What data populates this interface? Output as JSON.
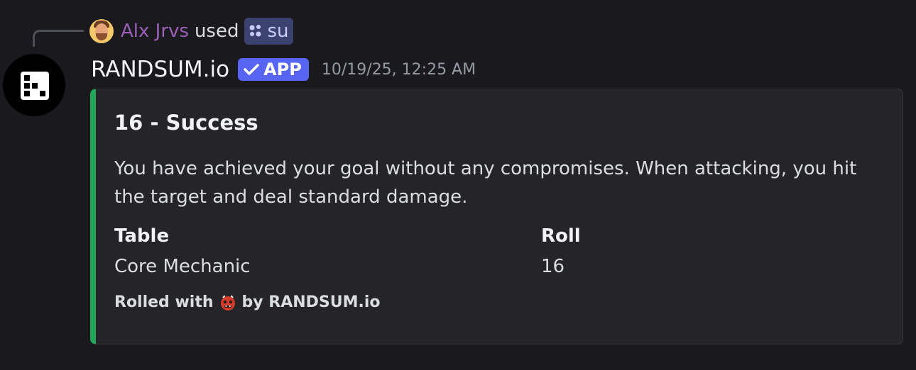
{
  "reply": {
    "user": "Alx Jrvs",
    "action": "used",
    "command": "su"
  },
  "message": {
    "author": "RANDSUM.io",
    "badge": "APP",
    "timestamp": "10/19/25, 12:25 AM"
  },
  "embed": {
    "accent_color": "#23a559",
    "title": "16 - Success",
    "description": "You have achieved your goal without any compromises. When attacking, you hit the target and deal standard damage.",
    "fields": [
      {
        "name": "Table",
        "value": "Core Mechanic"
      },
      {
        "name": "Roll",
        "value": "16"
      }
    ],
    "footer": {
      "prefix": "Rolled with",
      "icon": "ogre-icon",
      "suffix": "by RANDSUM.io"
    }
  },
  "colors": {
    "background": "#1a1a1e",
    "reply_user": "#9c5fb8",
    "badge": "#5865f2",
    "command_pill": "#3c4270"
  }
}
